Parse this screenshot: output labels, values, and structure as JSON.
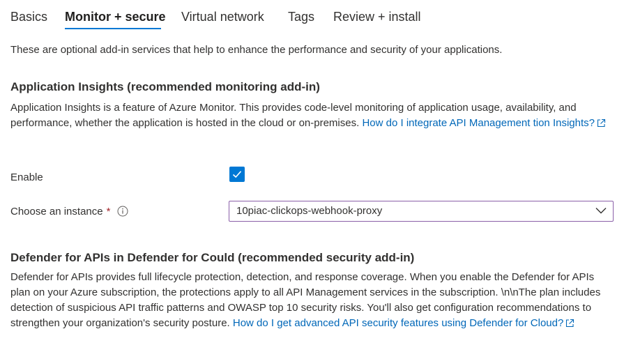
{
  "tabs": [
    {
      "label": "Basics"
    },
    {
      "label": "Monitor + secure",
      "active": true
    },
    {
      "label": "Virtual network"
    },
    {
      "label": "Tags"
    },
    {
      "label": "Review + install"
    }
  ],
  "intro": "These are optional add-in services that help to enhance the performance and security of your applications.",
  "app_insights": {
    "heading": "Application Insights (recommended monitoring add-in)",
    "description": "Application Insights is a feature of Azure Monitor. This provides code-level monitoring of application usage, availability, and performance, whether the application is hosted in the cloud or on-premises. ",
    "link": "How do I integrate API Management tion Insights?",
    "enable_label": "Enable",
    "enable_checked": true,
    "instance_label": "Choose an instance",
    "required_marker": "*",
    "instance_value": "10piac-clickops-webhook-proxy"
  },
  "defender": {
    "heading": "Defender for APIs in Defender for Could (recommended security add-in)",
    "description": "Defender for APIs provides full lifecycle protection, detection, and response coverage. When you enable the Defender for APIs plan on your Azure subscription, the protections apply to all API Management services in the subscription. \\n\\nThe plan includes detection of suspicious API traffic patterns and OWASP top 10 security risks. You'll also get configuration recommendations to strengthen your organization's security posture. ",
    "link": "How do I get advanced API security features using Defender for Cloud?"
  },
  "colors": {
    "accent": "#0078d4",
    "link": "#0067b8",
    "required": "#a4262c",
    "dropdown_border": "#8a5fa8"
  }
}
